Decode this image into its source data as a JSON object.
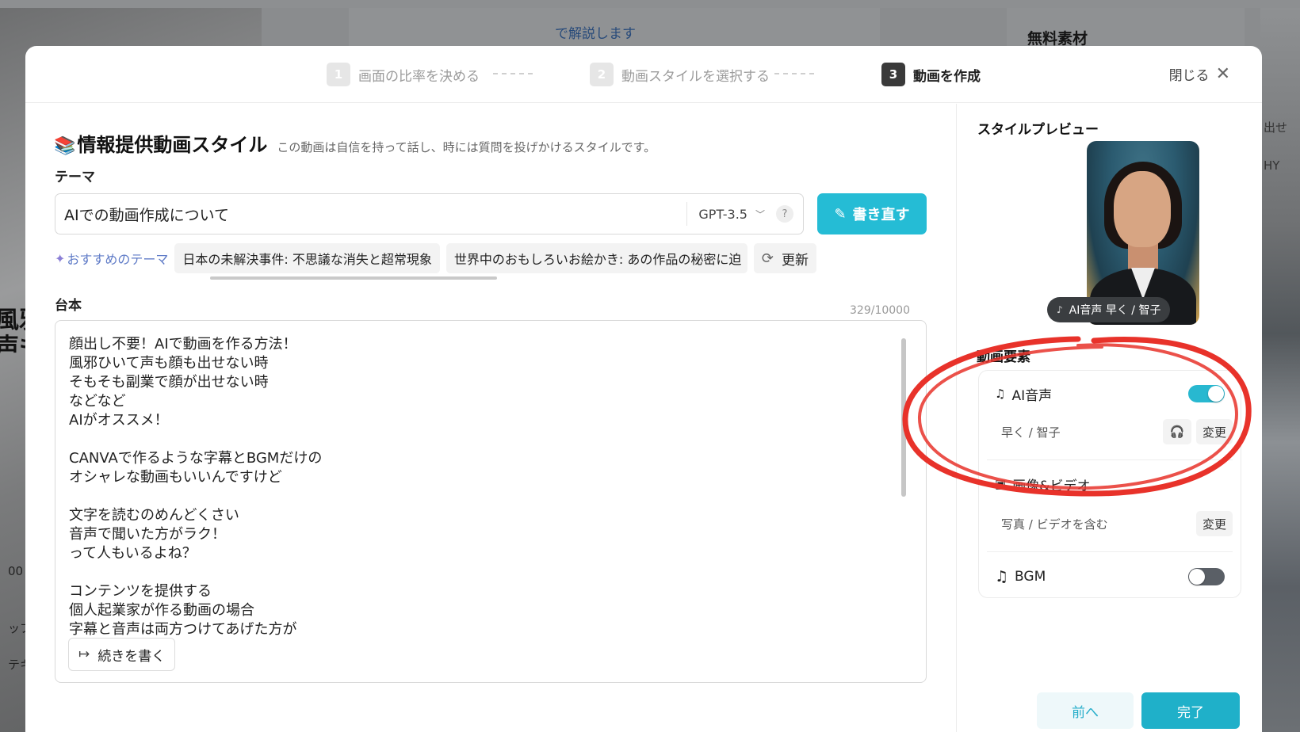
{
  "background": {
    "center_text": "で解説します",
    "right_title": "無料素材",
    "left_text_lines": [
      "風邪",
      "声も"
    ],
    "left_small": [
      "00",
      "ップ",
      "テキ"
    ],
    "far_right": [
      "出せ",
      "HY"
    ]
  },
  "steps": [
    {
      "num": "1",
      "label": "画面の比率を決める"
    },
    {
      "num": "2",
      "label": "動画スタイルを選択する"
    },
    {
      "num": "3",
      "label": "動画を作成"
    }
  ],
  "close_label": "閉じる",
  "style": {
    "icon": "📚",
    "title": "情報提供動画スタイル",
    "description": "この動画は自信を持って話し、時には質問を投げかけるスタイルです。"
  },
  "theme": {
    "label": "テーマ",
    "value": "AIでの動画作成について",
    "model": "GPT-3.5",
    "help": "?",
    "rewrite_label": "書き直す"
  },
  "recommend": {
    "label": "おすすめのテーマ",
    "chips": [
      "日本の未解決事件: 不思議な消失と超常現象",
      "世界中のおもしろいお絵かき: あの作品の秘密に迫"
    ],
    "refresh_label": "更新"
  },
  "script": {
    "label": "台本",
    "count": "329/10000",
    "text": "顔出し不要！AIで動画を作る方法！\n風邪ひいて声も顔も出せない時\nそもそも副業で顔が出せない時\nなどなど\nAIがオススメ！\n\nCANVAで作るような字幕とBGMだけの\nオシャレな動画もいいんですけど\n\n文字を読むのめんどくさい\n音声で聞いた方がラク！\nって人もいるよね？\n\nコンテンツを提供する\n個人起業家が作る動画の場合\n字幕と音声は両方つけてあげた方が",
    "continue_label": "続きを書く"
  },
  "preview": {
    "title": "スタイルプレビュー",
    "voice_badge": "AI音声  早く / 智子"
  },
  "elements": {
    "title": "動画要素",
    "ai_voice": {
      "label": "AI音声",
      "enabled": true,
      "value": "早く / 智子",
      "change": "変更"
    },
    "media": {
      "label": "画像&ビデオ",
      "value": "写真 / ビデオを含む",
      "change": "変更"
    },
    "bgm": {
      "label": "BGM",
      "enabled": false
    }
  },
  "footer": {
    "prev_label": "前へ",
    "done_label": "完了"
  },
  "colors": {
    "accent": "#25bcd5",
    "annotation": "#e8322a"
  }
}
